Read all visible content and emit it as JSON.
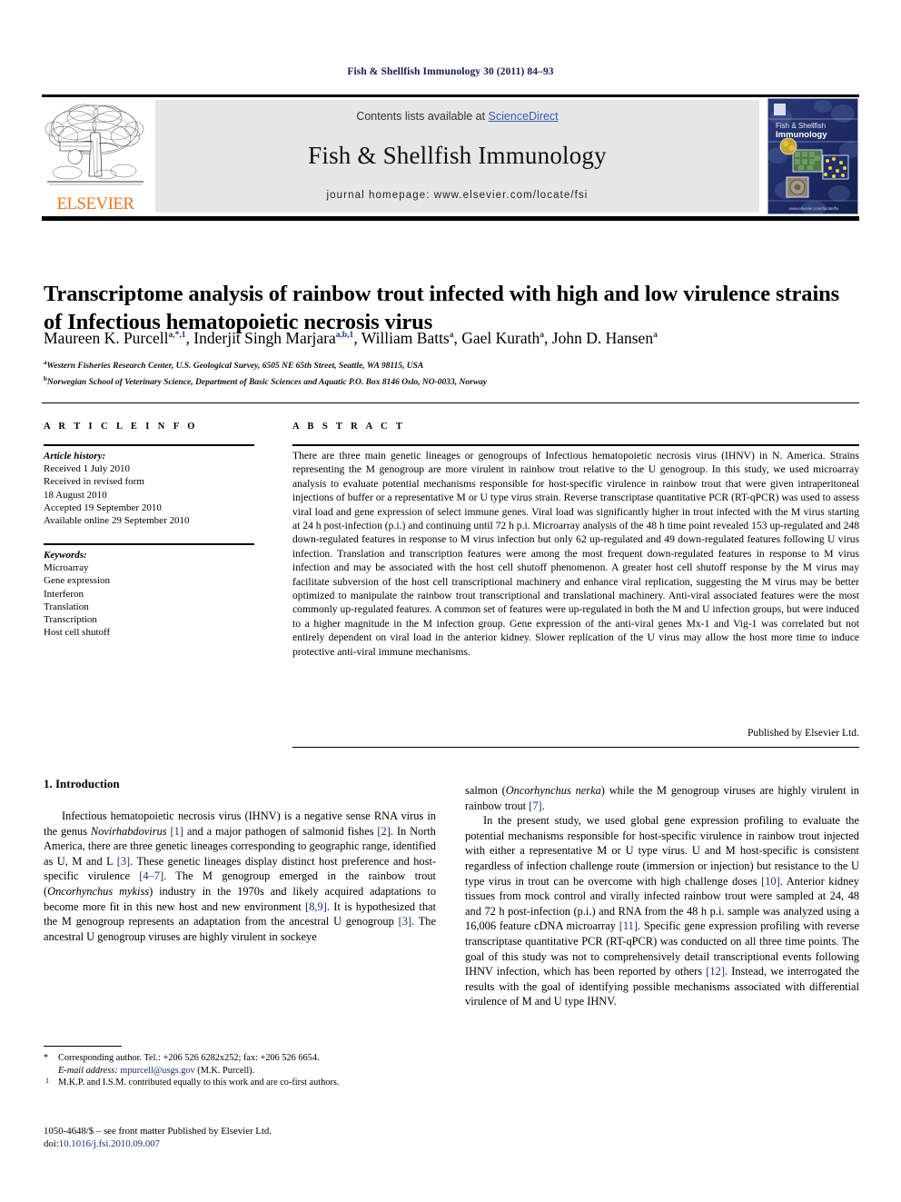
{
  "running_head": "Fish & Shellfish Immunology 30 (2011) 84–93",
  "masthead": {
    "contents_prefix": "Contents lists available at ",
    "sciencedirect": "ScienceDirect",
    "journal_title": "Fish & Shellfish Immunology",
    "homepage": "journal homepage: www.elsevier.com/locate/fsi",
    "elsevier_wordmark": "ELSEVIER",
    "cover_title_line1": "Fish & Shellfish",
    "cover_title_line2": "Immunology",
    "link_color": "#3b5bb5",
    "banner_bg": "#e6e6e6",
    "elsevier_orange": "#E87722"
  },
  "article": {
    "title": "Transcriptome analysis of rainbow trout infected with high and low virulence strains of Infectious hematopoietic necrosis virus",
    "authors": "Maureen K. Purcell, Inderjit Singh Marjara, William Batts, Gael Kurath, John D. Hansen",
    "affiliation_a": "Western Fisheries Research Center, U.S. Geological Survey, 6505 NE 65th Street, Seattle, WA 98115, USA",
    "affiliation_b": "Norwegian School of Veterinary Science, Department of Basic Sciences and Aquatic P.O. Box 8146 Oslo, NO-0033, Norway"
  },
  "info": {
    "heading": "A R T I C L E   I N F O",
    "history_label": "Article history:",
    "history": [
      "Received 1 July 2010",
      "Received in revised form",
      "18 August 2010",
      "Accepted 19 September 2010",
      "Available online 29 September 2010"
    ],
    "keywords_label": "Keywords:",
    "keywords": [
      "Microarray",
      "Gene expression",
      "Interferon",
      "Translation",
      "Transcription",
      "Host cell shutoff"
    ]
  },
  "abstract": {
    "heading": "A B S T R A C T",
    "text": "There are three main genetic lineages or genogroups of Infectious hematopoietic necrosis virus (IHNV) in N. America. Strains representing the M genogroup are more virulent in rainbow trout relative to the U genogroup. In this study, we used microarray analysis to evaluate potential mechanisms responsible for host-specific virulence in rainbow trout that were given intraperitoneal injections of buffer or a representative M or U type virus strain. Reverse transcriptase quantitative PCR (RT-qPCR) was used to assess viral load and gene expression of select immune genes. Viral load was significantly higher in trout infected with the M virus starting at 24 h post-infection (p.i.) and continuing until 72 h p.i. Microarray analysis of the 48 h time point revealed 153 up-regulated and 248 down-regulated features in response to M virus infection but only 62 up-regulated and 49 down-regulated features following U virus infection. Translation and transcription features were among the most frequent down-regulated features in response to M virus infection and may be associated with the host cell shutoff phenomenon. A greater host cell shutoff response by the M virus may facilitate subversion of the host cell transcriptional machinery and enhance viral replication, suggesting the M virus may be better optimized to manipulate the rainbow trout transcriptional and translational machinery. Anti-viral associated features were the most commonly up-regulated features. A common set of features were up-regulated in both the M and U infection groups, but were induced to a higher magnitude in the M infection group. Gene expression of the anti-viral genes Mx-1 and Vig-1 was correlated but not entirely dependent on viral load in the anterior kidney. Slower replication of the U virus may allow the host more time to induce protective anti-viral immune mechanisms.",
    "publisher": "Published by Elsevier Ltd."
  },
  "body": {
    "section_heading": "1. Introduction",
    "left_para_1": "Infectious hematopoietic necrosis virus (IHNV) is a negative sense RNA virus in the genus Novirhabdovirus [1] and a major pathogen of salmonid fishes [2]. In North America, there are three genetic lineages corresponding to geographic range, identified as U, M and L [3]. These genetic lineages display distinct host preference and host-specific virulence [4–7]. The M genogroup emerged in the rainbow trout (Oncorhynchus mykiss) industry in the 1970s and likely acquired adaptations to become more fit in this new host and new environment [8,9]. It is hypothesized that the M genogroup represents an adaptation from the ancestral U genogroup [3]. The ancestral U genogroup viruses are highly virulent in sockeye",
    "right_para_continued": "salmon (Oncorhynchus nerka) while the M genogroup viruses are highly virulent in rainbow trout [7].",
    "right_para_2": "In the present study, we used global gene expression profiling to evaluate the potential mechanisms responsible for host-specific virulence in rainbow trout injected with either a representative M or U type virus. U and M host-specific is consistent regardless of infection challenge route (immersion or injection) but resistance to the U type virus in trout can be overcome with high challenge doses [10]. Anterior kidney tissues from mock control and virally infected rainbow trout were sampled at 24, 48 and 72 h post-infection (p.i.) and RNA from the 48 h p.i. sample was analyzed using a 16,006 feature cDNA microarray [11]. Specific gene expression profiling with reverse transcriptase quantitative PCR (RT-qPCR) was conducted on all three time points. The goal of this study was not to comprehensively detail transcriptional events following IHNV infection, which has been reported by others [12]. Instead, we interrogated the results with the goal of identifying possible mechanisms associated with differential virulence of M and U type IHNV."
  },
  "footnotes": {
    "corresponding": "Corresponding author. Tel.: +206 526 6282x252; fax: +206 526 6654.",
    "email_label": "E-mail address:",
    "email": "mpurcell@usgs.gov",
    "email_suffix": "(M.K. Purcell).",
    "equal_contribution": "M.K.P. and I.S.M. contributed equally to this work and are co-first authors."
  },
  "imprint": {
    "line1": "1050-4648/$ – see front matter Published by Elsevier Ltd.",
    "doi_label": "doi:",
    "doi": "10.1016/j.fsi.2010.09.007"
  }
}
